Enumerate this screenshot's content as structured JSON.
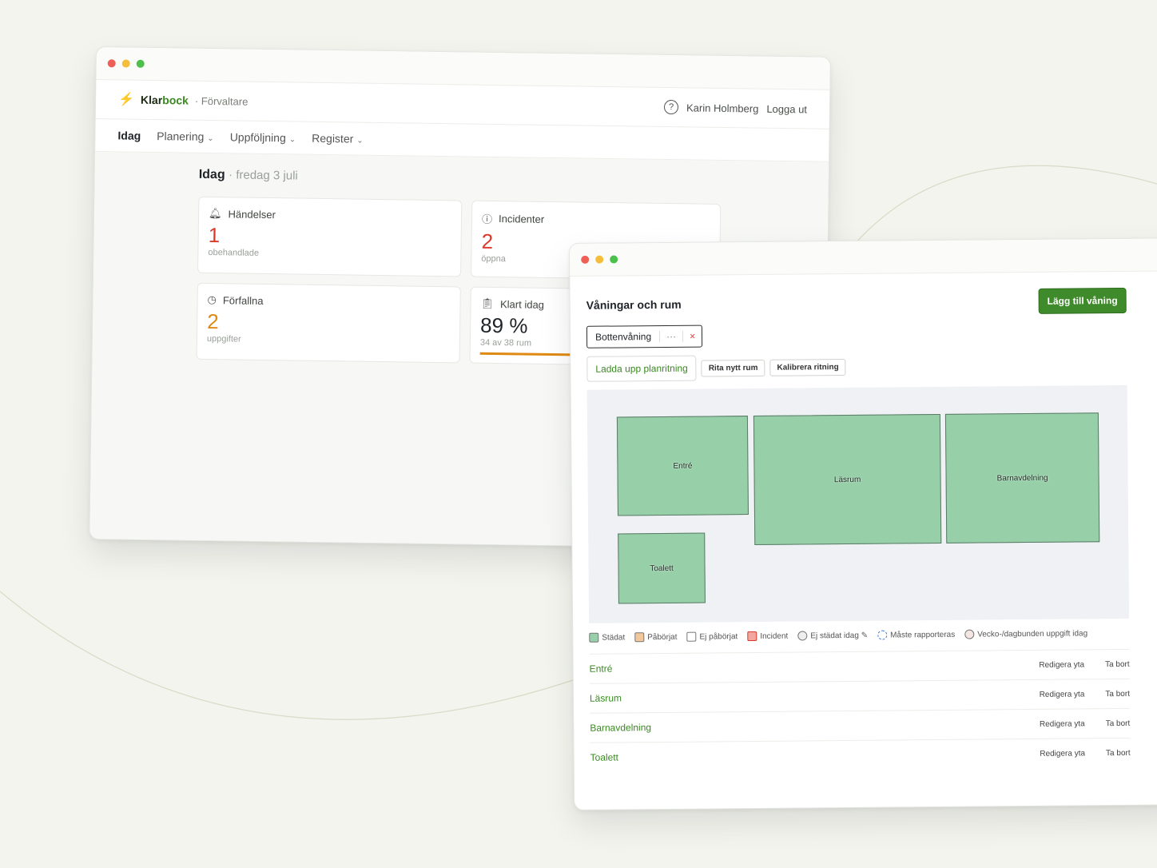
{
  "back_window": {
    "brand": {
      "name_part1": "Klar",
      "name_part2": "bock",
      "role": "· Förvaltare"
    },
    "user": {
      "help_glyph": "?",
      "name": "Karin Holmberg",
      "logout": "Logga ut"
    },
    "nav": {
      "today": "Idag",
      "planning": "Planering",
      "followup": "Uppföljning",
      "register": "Register"
    },
    "page": {
      "title": "Idag",
      "date": "· fredag 3 juli"
    },
    "cards": {
      "events": {
        "label": "Händelser",
        "value": "1",
        "sub": "obehandlade"
      },
      "incidents": {
        "label": "Incidenter",
        "value": "2",
        "sub": "öppna"
      },
      "overdue": {
        "label": "Förfallna",
        "value": "2",
        "sub": "uppgifter"
      },
      "done_today": {
        "label": "Klart idag",
        "value": "89 %",
        "sub": "34 av 38 rum",
        "progress": 0.89
      }
    }
  },
  "front_window": {
    "title": "Våningar och rum",
    "add_floor_button": "Lägg till våning",
    "floor": {
      "name": "Bottenvåning",
      "options": "···",
      "delete": "×"
    },
    "toolbar": {
      "upload": "Ladda upp planritning",
      "draw": "Rita nytt rum",
      "calibrate": "Kalibrera ritning"
    },
    "rooms_on_plan": {
      "entre": "Entré",
      "lasrum": "Läsrum",
      "barnavdelning": "Barnavdelning",
      "toalett": "Toalett"
    },
    "legend": {
      "cleaned": "Städat",
      "started": "Påbörjat",
      "not_started": "Ej påbörjat",
      "incident": "Incident",
      "not_cleaned_today": "Ej städat idag ✎",
      "must_report": "Måste rapporteras",
      "recurring": "Vecko-/dagbunden uppgift idag"
    },
    "room_rows": [
      {
        "name": "Entré",
        "edit": "Redigera yta",
        "remove": "Ta bort"
      },
      {
        "name": "Läsrum",
        "edit": "Redigera yta",
        "remove": "Ta bort"
      },
      {
        "name": "Barnavdelning",
        "edit": "Redigera yta",
        "remove": "Ta bort"
      },
      {
        "name": "Toalett",
        "edit": "Redigera yta",
        "remove": "Ta bort"
      }
    ]
  },
  "colors": {
    "accent_green": "#3f8a2a",
    "room_fill": "#96cfa8",
    "alert_red": "#d93a2b",
    "warning_orange": "#e08a13"
  }
}
